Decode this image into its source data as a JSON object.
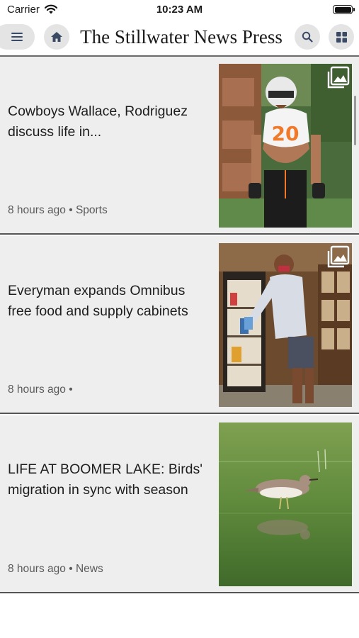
{
  "status": {
    "carrier": "Carrier",
    "time": "10:23 AM"
  },
  "header": {
    "title": "The Stillwater News Press"
  },
  "icons": {
    "menu": "hamburger-icon",
    "home": "home-icon",
    "search": "search-icon",
    "sections": "grid-icon",
    "gallery": "photo-gallery-icon"
  },
  "colors": {
    "button_bg": "#e4e4e4",
    "card_bg": "#eeeeee",
    "meta_text": "#5a5a5a"
  },
  "articles": [
    {
      "headline": "Cowboys Wallace, Rodriguez discuss life in...",
      "time": "8 hours ago",
      "separator": "•",
      "section": "Sports",
      "has_gallery": true
    },
    {
      "headline": "Everyman expands Omnibus free food and supply cabinets",
      "time": "8 hours ago",
      "separator": "•",
      "section": "",
      "has_gallery": true
    },
    {
      "headline": "LIFE AT BOOMER LAKE: Birds' migration in sync with season",
      "time": "8 hours ago",
      "separator": "•",
      "section": "News",
      "has_gallery": false
    }
  ]
}
